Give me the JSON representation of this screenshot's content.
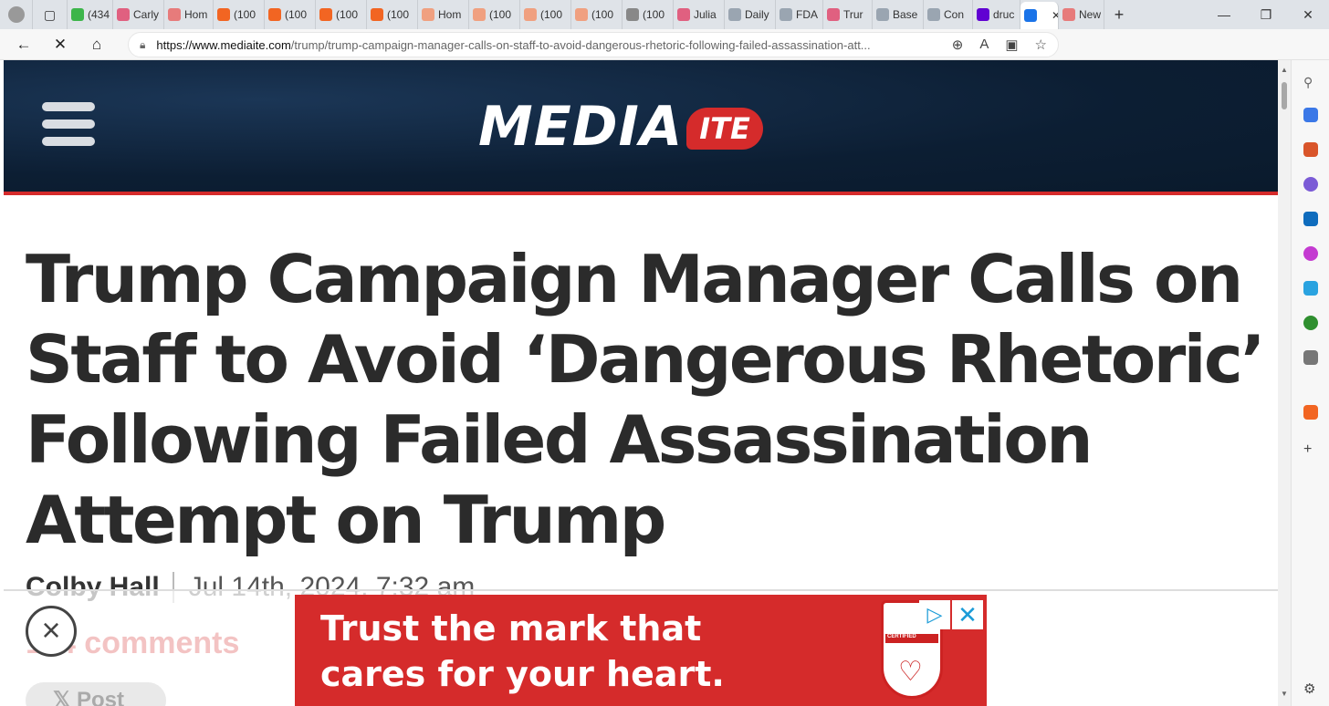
{
  "browser": {
    "tabs": [
      {
        "label": "(434",
        "color": "#3cb54a"
      },
      {
        "label": "Carly",
        "color": "#e06080"
      },
      {
        "label": "Hom",
        "color": "#e77b7b"
      },
      {
        "label": "(100",
        "color": "#f26522"
      },
      {
        "label": "(100",
        "color": "#f26522"
      },
      {
        "label": "(100",
        "color": "#f26522"
      },
      {
        "label": "(100",
        "color": "#f26522"
      },
      {
        "label": "Hom",
        "color": "#f0a080"
      },
      {
        "label": "(100",
        "color": "#f0a080"
      },
      {
        "label": "(100",
        "color": "#f0a080"
      },
      {
        "label": "(100",
        "color": "#f0a080"
      },
      {
        "label": "(100",
        "color": "#888888"
      },
      {
        "label": "Julia",
        "color": "#e06080"
      },
      {
        "label": "Daily",
        "color": "#9aa5b1"
      },
      {
        "label": "FDA",
        "color": "#9aa5b1"
      },
      {
        "label": "Trur",
        "color": "#e06080"
      },
      {
        "label": "Base",
        "color": "#9aa5b1"
      },
      {
        "label": "Con",
        "color": "#9aa5b1"
      },
      {
        "label": "druc",
        "color": "#6001d2"
      },
      {
        "label": "",
        "color": "#1a73e8"
      },
      {
        "label": "New",
        "color": "#e77b7b"
      }
    ],
    "active_tab_index": 19,
    "url_domain": "https://www.mediaite.com",
    "url_path": "/trump/trump-campaign-manager-calls-on-staff-to-avoid-dangerous-rhetoric-following-failed-assassination-att..."
  },
  "site": {
    "logo_word": "MEDIA",
    "logo_badge": "ITE",
    "accent_color": "#d52b2b"
  },
  "article": {
    "headline": "Trump Campaign Manager Calls on Staff to Avoid ‘Dangerous Rhetoric’ Following Failed Assassination Attempt on Trump",
    "author": "Colby Hall",
    "date": "Jul 14th, 2024, 7:32 am",
    "comments": "114 comments",
    "post_label": "Post"
  },
  "ad": {
    "text_line1": "Trust the mark that",
    "text_line2": "cares for your heart.",
    "seal_label": "CERTIFIED"
  }
}
